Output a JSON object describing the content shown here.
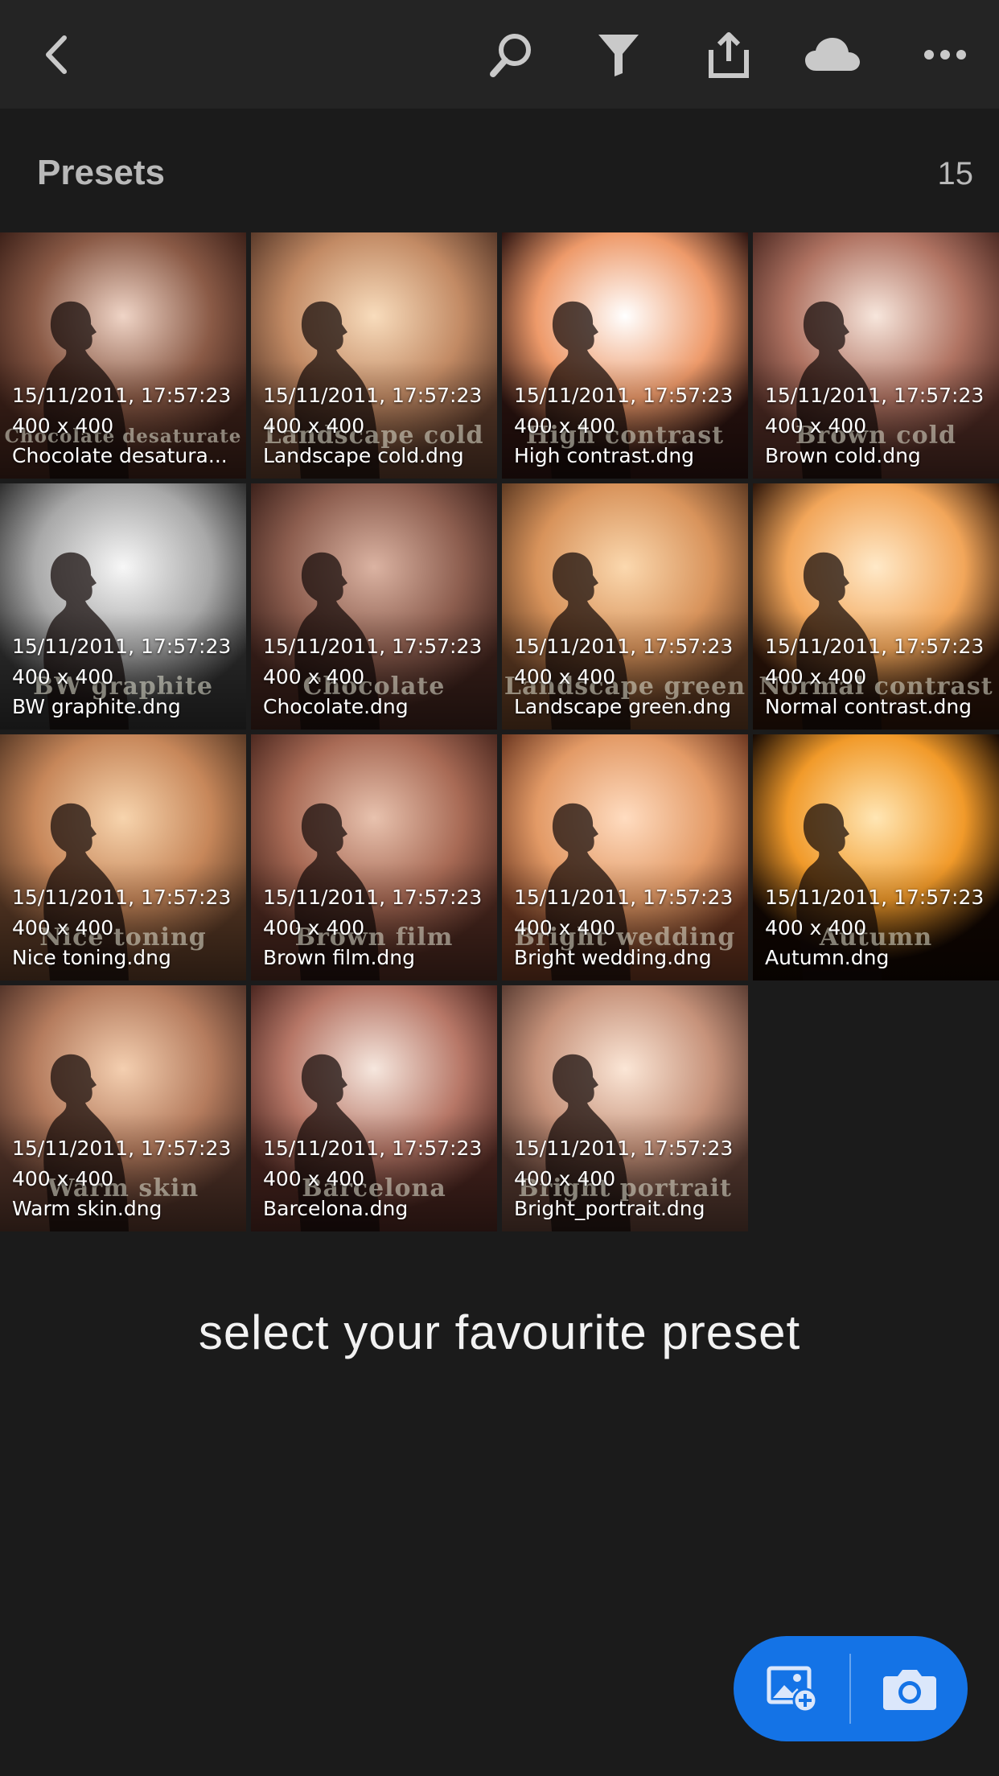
{
  "toolbar": {
    "icons": [
      "back-icon",
      "search-icon",
      "filter-icon",
      "share-icon",
      "cloud-icon",
      "more-icon"
    ]
  },
  "section": {
    "title": "Presets",
    "count": "15"
  },
  "presets": [
    {
      "date": "15/11/2011, 17:57:23",
      "size": "400 x 400",
      "filename": "Chocolate desatura...",
      "watermark": "Chocolate desaturate",
      "colors": [
        "#efd4c6",
        "#8a5a46",
        "#3d2119"
      ]
    },
    {
      "date": "15/11/2011, 17:57:23",
      "size": "400 x 400",
      "filename": "Landscape cold.dng",
      "watermark": "Landscape cold",
      "colors": [
        "#f8dcbc",
        "#c28a64",
        "#5a3a2a"
      ]
    },
    {
      "date": "15/11/2011, 17:57:23",
      "size": "400 x 400",
      "filename": "High contrast.dng",
      "watermark": "High contrast",
      "colors": [
        "#ffffff",
        "#ee9a6a",
        "#2b1310"
      ]
    },
    {
      "date": "15/11/2011, 17:57:23",
      "size": "400 x 400",
      "filename": "Brown cold.dng",
      "watermark": "Brown cold",
      "colors": [
        "#f7e6dc",
        "#b07362",
        "#4d2a23"
      ]
    },
    {
      "date": "15/11/2011, 17:57:23",
      "size": "400 x 400",
      "filename": "BW graphite.dng",
      "watermark": "BW graphite",
      "colors": [
        "#f7f7f7",
        "#a8a8a8",
        "#2e2e2e"
      ]
    },
    {
      "date": "15/11/2011, 17:57:23",
      "size": "400 x 400",
      "filename": "Chocolate.dng",
      "watermark": "Chocolate",
      "colors": [
        "#dbb3a2",
        "#8d5e4f",
        "#3c211b"
      ]
    },
    {
      "date": "15/11/2011, 17:57:23",
      "size": "400 x 400",
      "filename": "Landscape green.dng",
      "watermark": "Landscape green",
      "colors": [
        "#fbd8ae",
        "#d8935b",
        "#5e3a22"
      ]
    },
    {
      "date": "15/11/2011, 17:57:23",
      "size": "400 x 400",
      "filename": "Normal contrast.dng",
      "watermark": "Normal contrast",
      "colors": [
        "#ffe9c8",
        "#f2a65a",
        "#2a1308"
      ]
    },
    {
      "date": "15/11/2011, 17:57:23",
      "size": "400 x 400",
      "filename": "Nice toning.dng",
      "watermark": "Nice toning",
      "colors": [
        "#f7d4ad",
        "#c7875a",
        "#5a3a26"
      ]
    },
    {
      "date": "15/11/2011, 17:57:23",
      "size": "400 x 400",
      "filename": "Brown film.dng",
      "watermark": "Brown film",
      "colors": [
        "#e8c2ae",
        "#a86a55",
        "#4d2920"
      ]
    },
    {
      "date": "15/11/2011, 17:57:23",
      "size": "400 x 400",
      "filename": "Bright wedding.dng",
      "watermark": "Bright wedding",
      "colors": [
        "#ffdcc0",
        "#e39a66",
        "#6a3620"
      ]
    },
    {
      "date": "15/11/2011, 17:57:23",
      "size": "400 x 400",
      "filename": "Autumn.dng",
      "watermark": "Autumn",
      "colors": [
        "#ffe6b4",
        "#f19a2a",
        "#120702"
      ]
    },
    {
      "date": "15/11/2011, 17:57:23",
      "size": "400 x 400",
      "filename": "Warm skin.dng",
      "watermark": "Warm skin",
      "colors": [
        "#f4cfb0",
        "#b57c5e",
        "#54352a"
      ]
    },
    {
      "date": "15/11/2011, 17:57:23",
      "size": "400 x 400",
      "filename": "Barcelona.dng",
      "watermark": "Barcelona",
      "colors": [
        "#f6e7de",
        "#b77767",
        "#4b2620"
      ]
    },
    {
      "date": "15/11/2011, 17:57:23",
      "size": "400 x 400",
      "filename": "Bright_portrait.dng",
      "watermark": "Bright portrait",
      "colors": [
        "#fbe6d6",
        "#c6927a",
        "#5b3d33"
      ]
    }
  ],
  "caption": "select your favourite preset",
  "fab": {
    "icons": [
      "add-photo-icon",
      "camera-icon"
    ],
    "color": "#1473e6"
  }
}
